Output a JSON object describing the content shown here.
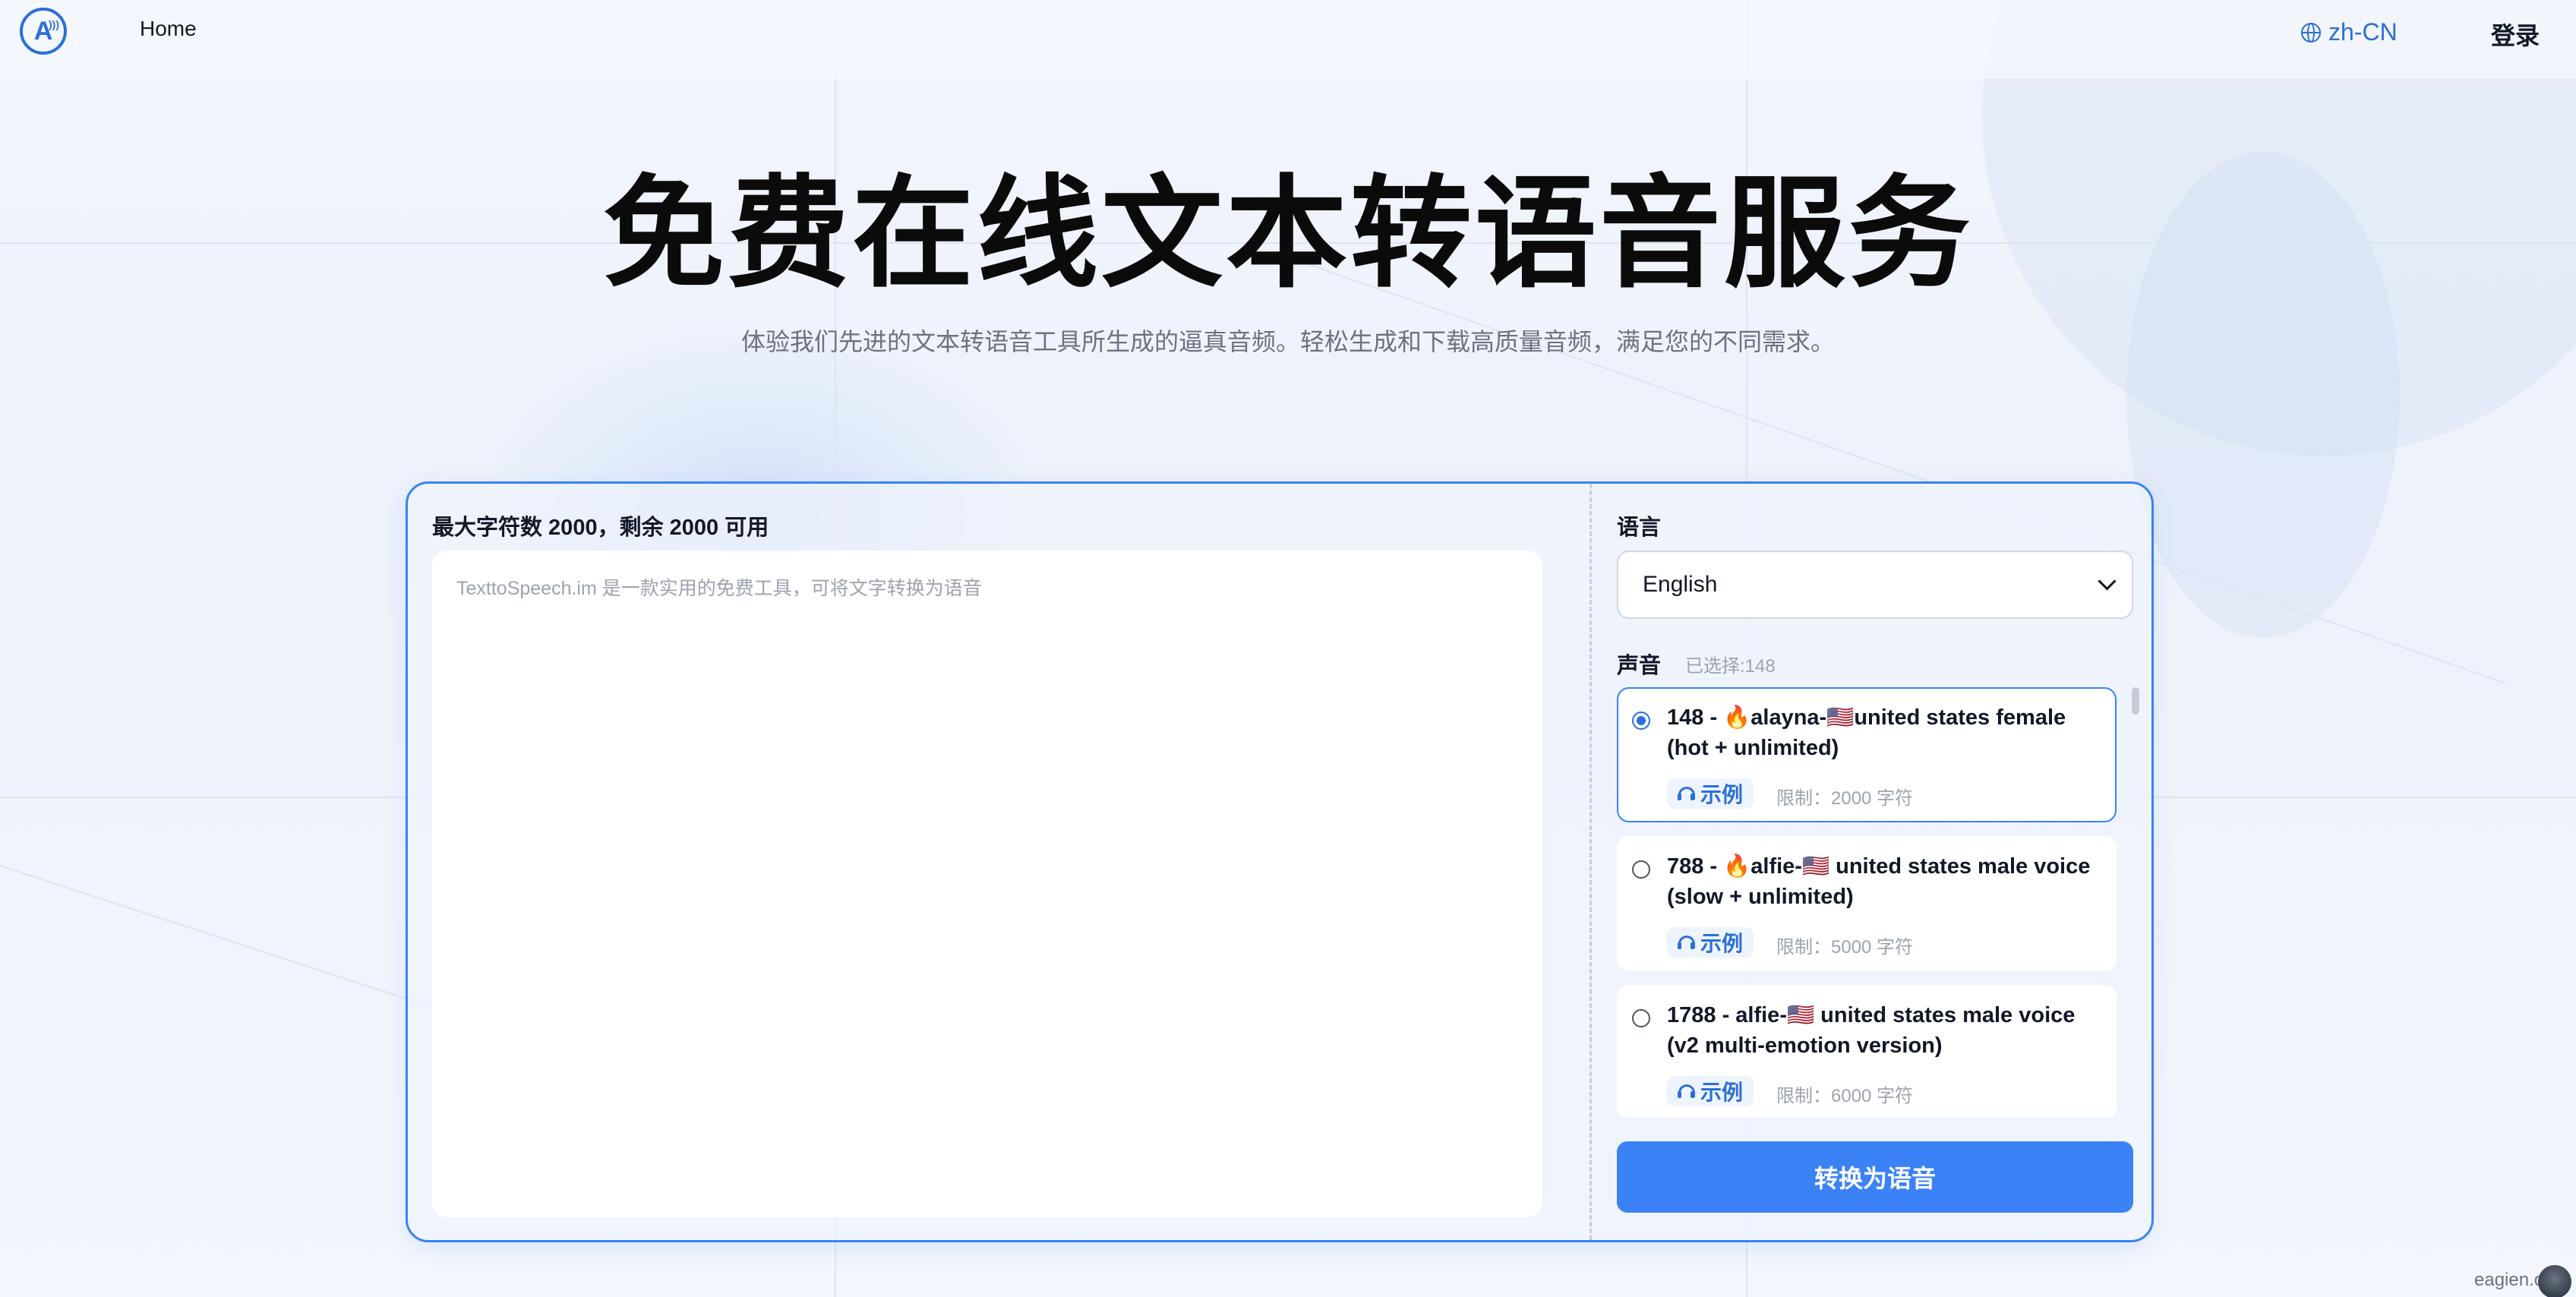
{
  "header": {
    "home_label": "Home",
    "language_label": "zh-CN",
    "login_label": "登录",
    "logo_letter": "A"
  },
  "hero": {
    "title": "免费在线文本转语音服务",
    "subtitle": "体验我们先进的文本转语音工具所生成的逼真音频。轻松生成和下载高质量音频，满足您的不同需求。"
  },
  "editor": {
    "char_limit_text": "最大字符数 2000，剩余 2000 可用",
    "placeholder": "TexttoSpeech.im 是一款实用的免费工具，可将文字转换为语音"
  },
  "language": {
    "label": "语言",
    "selected": "English"
  },
  "voices": {
    "label": "声音",
    "selected_text": "已选择:148",
    "items": [
      {
        "name": "148 - 🔥alayna-🇺🇸united states female (hot + unlimited)",
        "demo_label": "示例",
        "limit": "限制：2000 字符",
        "selected": true
      },
      {
        "name": "788 - 🔥alfie-🇺🇸 united states male voice (slow + unlimited)",
        "demo_label": "示例",
        "limit": "限制：5000 字符",
        "selected": false
      },
      {
        "name": "1788 - alfie-🇺🇸 united states male voice (v2 multi-emotion version)",
        "demo_label": "示例",
        "limit": "限制：6000 字符",
        "selected": false
      }
    ]
  },
  "convert_button": "转换为语音",
  "watermark": "eagien.c",
  "colors": {
    "accent": "#3b82f6",
    "brand": "#2b6fd6",
    "background": "#eef3fb"
  }
}
